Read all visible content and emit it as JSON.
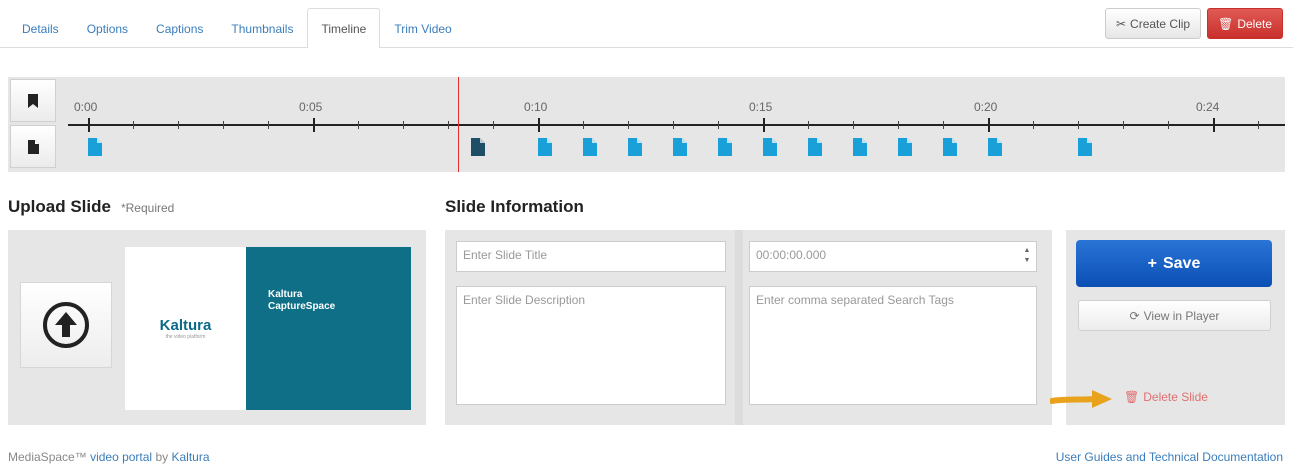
{
  "tabs": [
    {
      "label": "Details"
    },
    {
      "label": "Options"
    },
    {
      "label": "Captions"
    },
    {
      "label": "Thumbnails"
    },
    {
      "label": "Timeline",
      "active": true
    },
    {
      "label": "Trim Video"
    }
  ],
  "top_actions": {
    "create_clip": "Create Clip",
    "delete": "Delete"
  },
  "timeline": {
    "tick_labels": [
      "0:00",
      "0:05",
      "0:10",
      "0:15",
      "0:20",
      "0:24"
    ],
    "playhead_time": "0:08.5",
    "slide_times_sec": [
      0,
      8.5,
      10,
      11,
      12,
      13,
      14,
      15,
      16,
      17,
      18,
      19,
      20,
      22
    ]
  },
  "upload": {
    "title": "Upload Slide",
    "required": "*Required"
  },
  "thumbnail": {
    "logo_text": "Kaltura",
    "logo_sub": "the video platform",
    "title_line1": "Kaltura",
    "title_line2": "CaptureSpace"
  },
  "slide_info": {
    "title": "Slide Information",
    "title_placeholder": "Enter Slide Title",
    "time_value": "00:00:00.000",
    "description_placeholder": "Enter Slide Description",
    "tags_placeholder": "Enter comma separated Search Tags"
  },
  "actions": {
    "save": "Save",
    "view_in_player": "View in Player",
    "delete_slide": "Delete Slide"
  },
  "footer": {
    "left_prefix": "MediaSpace™",
    "left_link1": "video portal",
    "left_by": "by",
    "left_link2": "Kaltura",
    "right_link": "User Guides and Technical Documentation"
  },
  "colors": {
    "link": "#3a7dbb",
    "danger": "#c9302c",
    "primary": "#0b4fb5",
    "slide_marker": "#1aa0d8",
    "playhead": "#e03030"
  }
}
